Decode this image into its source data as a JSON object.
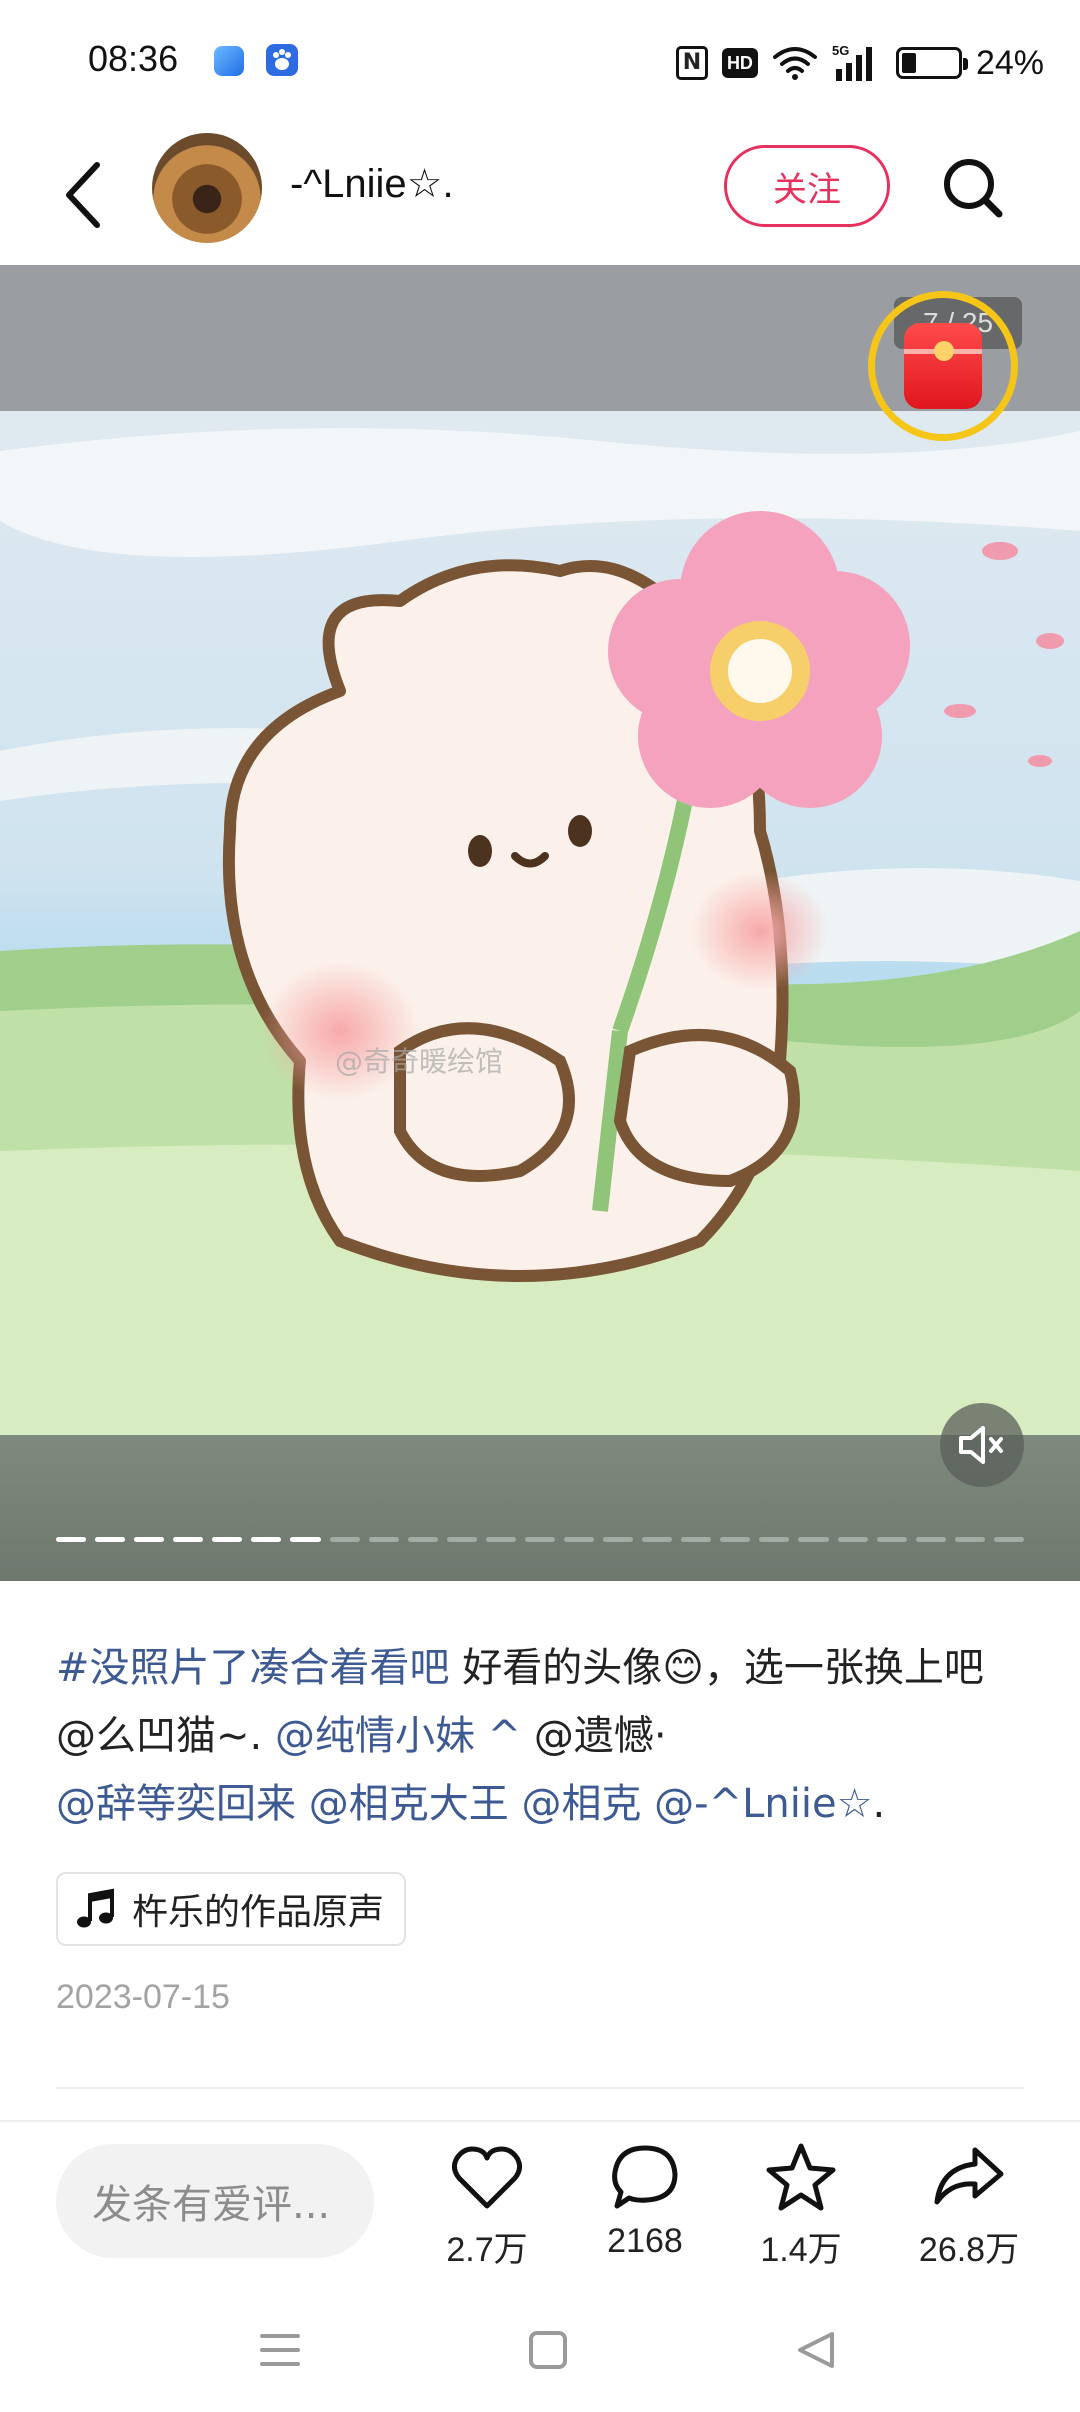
{
  "status_bar": {
    "time": "08:36",
    "battery": "24%",
    "hd_label": "HD",
    "network_label": "5G",
    "nfc_label": "N",
    "app_icons": [
      "blue-app-icon",
      "baidu-paw-icon"
    ]
  },
  "header": {
    "author_name": "-^Lniie☆.",
    "follow_label": "关注"
  },
  "media": {
    "page_indicator": "7 / 25",
    "current_page": 7,
    "total_pages": 25,
    "watermark": "@奇奇暖绘馆"
  },
  "caption": {
    "hashtag": "#没照片了凑合着看吧",
    "text_1": " 好看的头像😊，选一张换上吧 @么凹猫~. ",
    "mention_1": "@纯情小妹 ^",
    "text_2": " @遗憾·",
    "mention_2": "@辞等奕回来",
    "text_3": " ",
    "mention_3": "@相克大王",
    "text_4": " ",
    "mention_4": "@相克",
    "text_5": " ",
    "mention_5": "@-^Lniie☆",
    "text_6": "."
  },
  "sound": {
    "label": "杵乐的作品原声"
  },
  "post_date": "2023-07-15",
  "bottom_bar": {
    "comment_placeholder": "发条有爱评...",
    "likes": "2.7万",
    "comments": "2168",
    "favorites": "1.4万",
    "shares": "26.8万"
  },
  "colors": {
    "accent": "#e8305e",
    "link": "#3d5a92",
    "redpacket_ring": "#f5c518"
  }
}
